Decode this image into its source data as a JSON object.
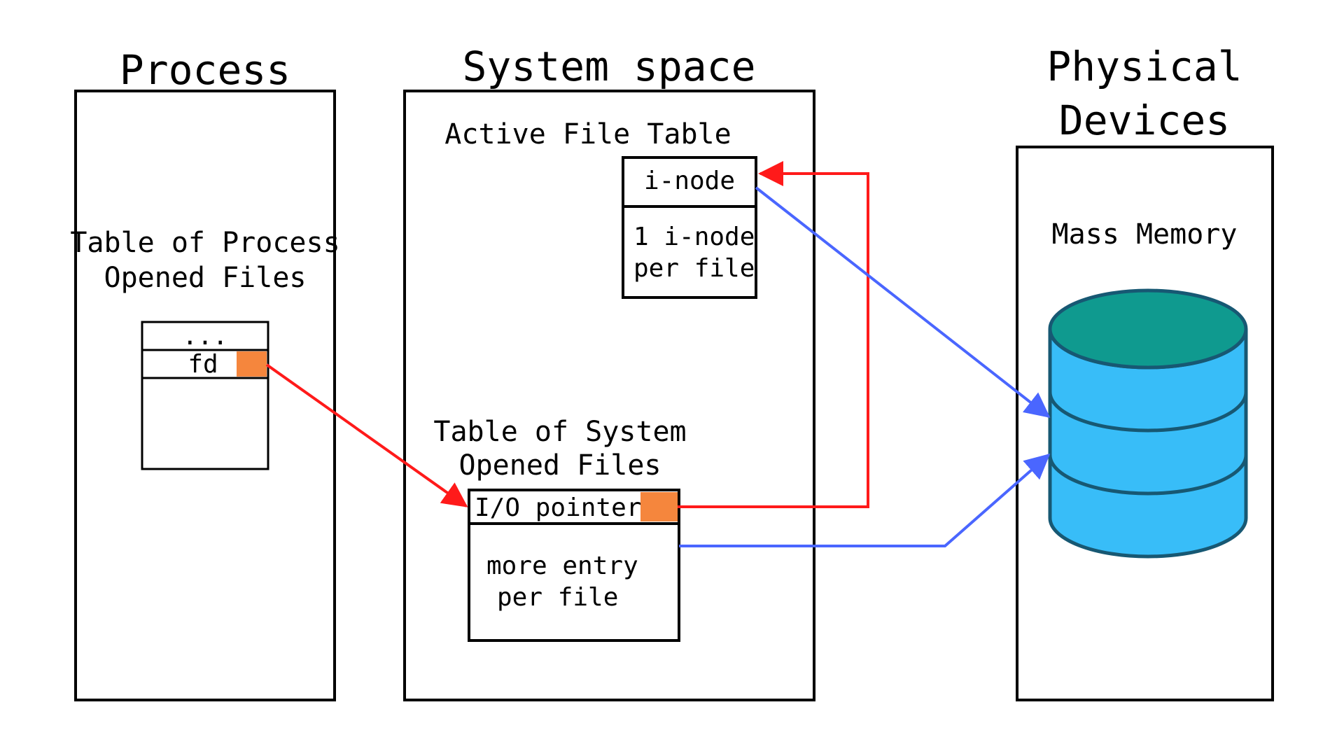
{
  "process": {
    "title": "Process",
    "subtitle_l1": "Table of Process",
    "subtitle_l2": "Opened Files",
    "row0": "...",
    "row1": "fd"
  },
  "system": {
    "title": "System space",
    "aft_title": "Active File Table",
    "inode_label": "i-node",
    "inode_note_l1": "1 i-node",
    "inode_note_l2": "per file",
    "sof_title_l1": "Table of System",
    "sof_title_l2": "Opened Files",
    "io_ptr_label": "I/O pointer",
    "sof_note_l1": "more entry",
    "sof_note_l2": "per file"
  },
  "phys": {
    "title_l1": "Physical",
    "title_l2": "Devices",
    "mass_mem": "Mass Memory"
  },
  "colors": {
    "arrow_red": "#ff1a1a",
    "arrow_blue": "#4a66ff",
    "highlight": "#f5863d",
    "db_body": "#38bdf8",
    "db_top": "#0f9a8f",
    "db_edge": "#175873"
  }
}
